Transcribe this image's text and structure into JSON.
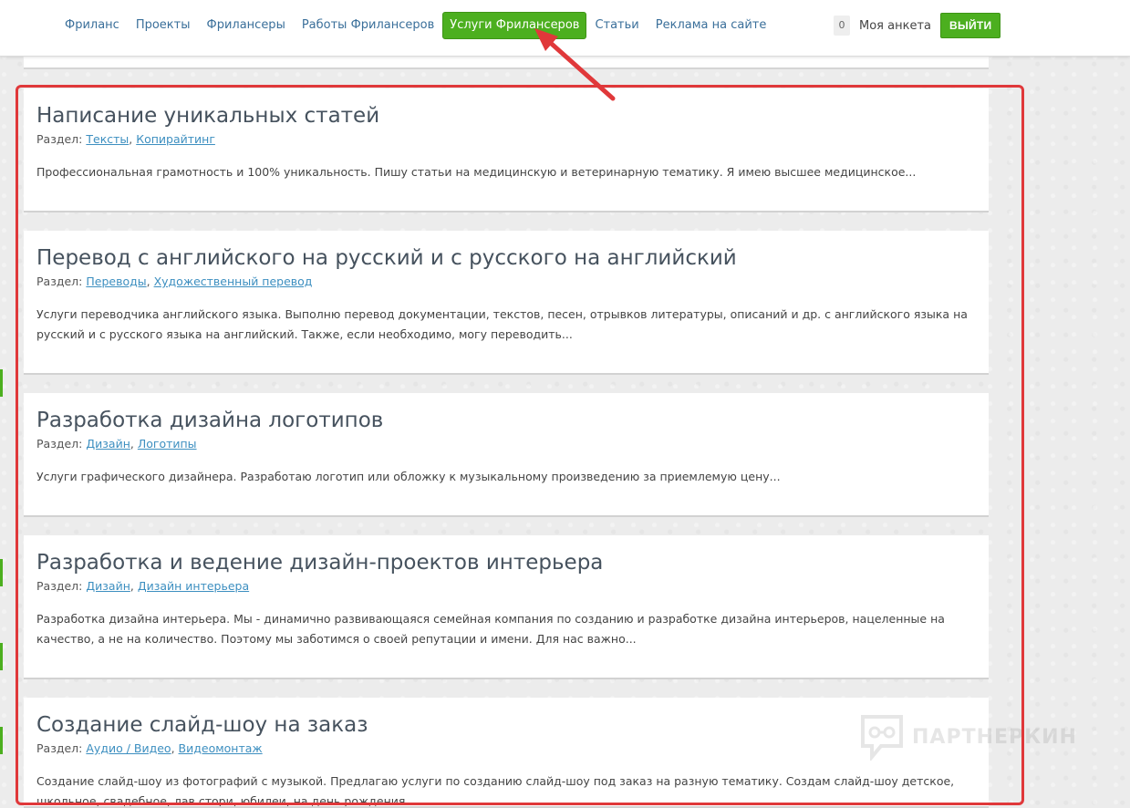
{
  "nav": {
    "items": [
      {
        "label": "Фриланс",
        "active": false
      },
      {
        "label": "Проекты",
        "active": false
      },
      {
        "label": "Фрилансеры",
        "active": false
      },
      {
        "label": "Работы Фрилансеров",
        "active": false
      },
      {
        "label": "Услуги Фрилансеров",
        "active": true
      },
      {
        "label": "Статьи",
        "active": false
      },
      {
        "label": "Реклама на сайте",
        "active": false
      }
    ]
  },
  "user": {
    "notifications_count": "0",
    "profile_label": "Моя анкета",
    "logout_label": "ВЫЙТИ"
  },
  "category_prefix": "Раздел:",
  "services": [
    {
      "title": "Написание уникальных статей",
      "categories": [
        "Тексты",
        "Копирайтинг"
      ],
      "description": "Профессиональная грамотность и 100% уникальность. Пишу статьи на медицинскую и ветеринарную тематику. Я имею высшее медицинское..."
    },
    {
      "title": "Перевод с английского на русский и с русского на английский",
      "categories": [
        "Переводы",
        "Художественный перевод"
      ],
      "description": "Услуги переводчика английского языка. Выполню перевод документации, текстов, песен, отрывков литературы, описаний и др. с английского языка на русский и с русского языка на английский. Также, если необходимо, могу переводить..."
    },
    {
      "title": "Разработка дизайна логотипов",
      "categories": [
        "Дизайн",
        "Логотипы"
      ],
      "description": "Услуги графического дизайнера. Разработаю логотип или обложку к музыкальному произведению за приемлемую цену..."
    },
    {
      "title": "Разработка и ведение дизайн-проектов интерьера",
      "categories": [
        "Дизайн",
        "Дизайн интерьера"
      ],
      "description": "Разработка дизайна интерьера. Мы - динамично развивающаяся семейная компания по созданию и разработке дизайна интерьеров, нацеленные на качество, а не на количество. Поэтому мы заботимся о своей репутации и имени. Для нас важно..."
    },
    {
      "title": "Создание слайд-шоу на заказ",
      "categories": [
        "Аудио / Видео",
        "Видеомонтаж"
      ],
      "description": "Создание слайд-шоу из фотографий с музыкой. Предлагаю услуги по созданию слайд-шоу под заказ на разную тематику. Создам слайд-шоу детское, школьное, свадебное, лав стори, юбилеи, на день рождения..."
    }
  ],
  "watermark": {
    "text": "ПАРТНЕРКИН",
    "icon": "chat-bubble-glasses-icon"
  },
  "colors": {
    "accent_green": "#4caf1f",
    "highlight_red": "#e0383a",
    "link_blue": "#3d8fc0"
  }
}
